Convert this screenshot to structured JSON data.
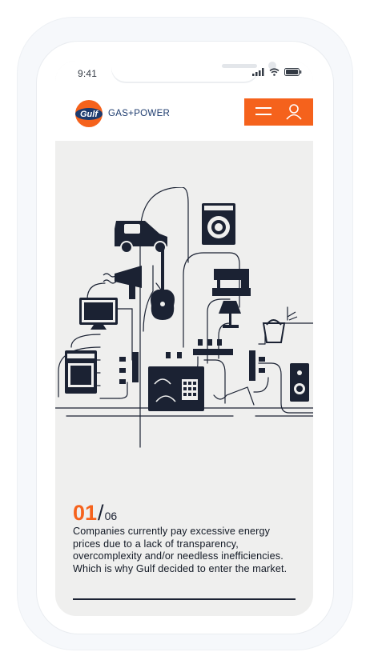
{
  "status_bar": {
    "time": "9:41"
  },
  "brand": {
    "logo_text": "Gulf",
    "name": "GAS+POWER"
  },
  "header": {
    "menu_icon": "hamburger-icon",
    "user_icon": "user-icon"
  },
  "slide": {
    "current": "01",
    "separator": "/",
    "total": "06",
    "text": "Companies currently pay excessive energy prices due to a lack of transparency, overcomplexity and/or needless inefficiencies. Which is why Gulf decided to enter the market."
  },
  "colors": {
    "accent": "#f5621c",
    "navy": "#1b2233",
    "background": "#efefee"
  }
}
